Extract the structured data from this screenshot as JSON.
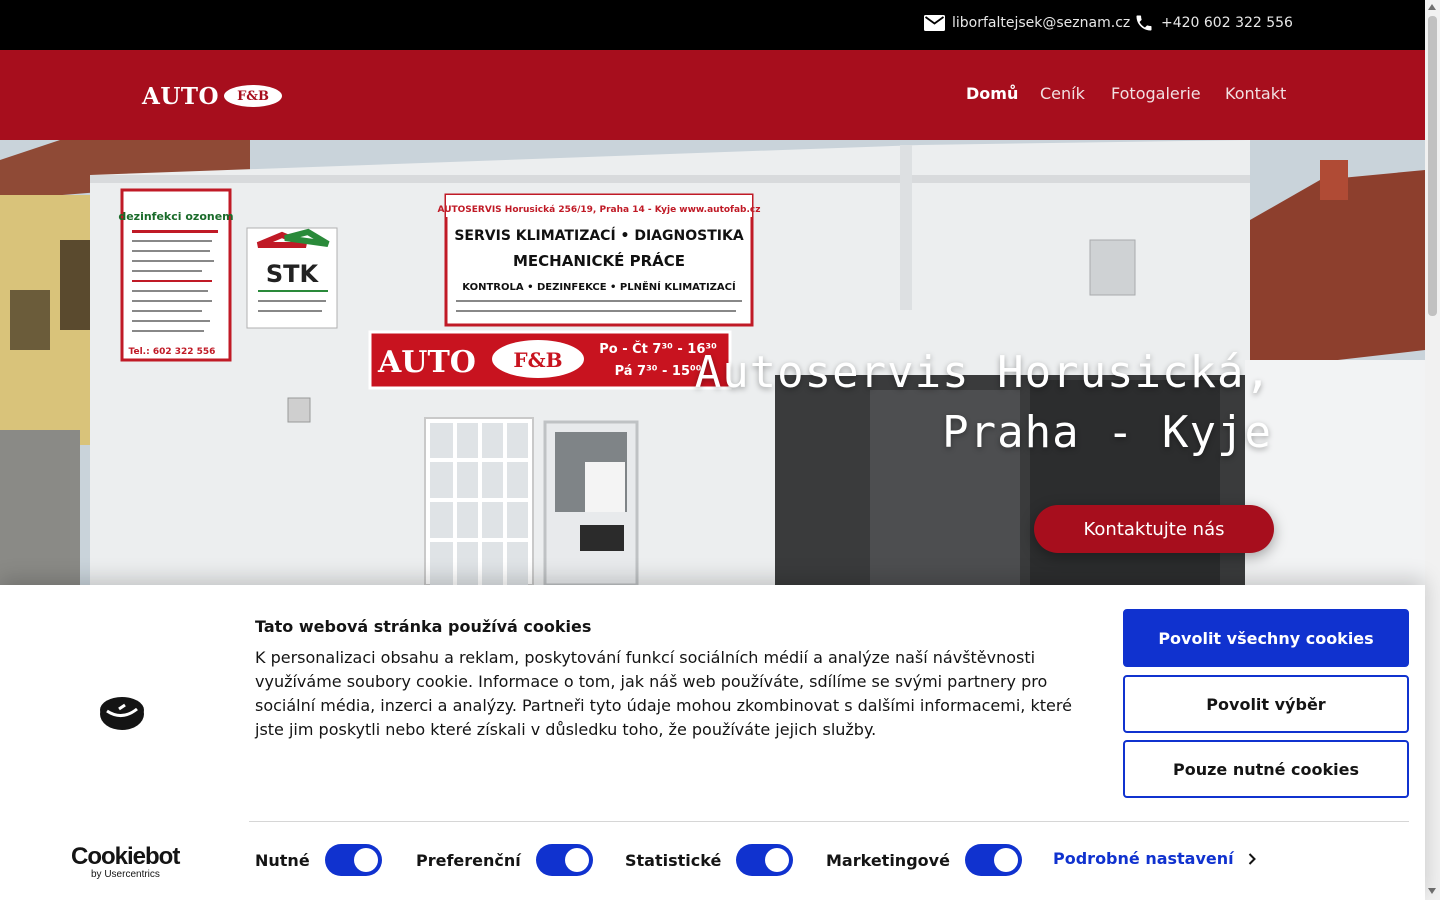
{
  "topbar": {
    "email": "liborfaltejsek@seznam.cz",
    "phone": "+420 602 322 556",
    "email_icon": "mail-icon",
    "phone_icon": "phone-icon"
  },
  "header": {
    "logo_word": "AUTO",
    "logo_badge": "F&B",
    "nav": [
      {
        "label": "Domů",
        "active": true
      },
      {
        "label": "Ceník",
        "active": false
      },
      {
        "label": "Fotogalerie",
        "active": false
      },
      {
        "label": "Kontakt",
        "active": false
      }
    ]
  },
  "hero": {
    "title_line1": "Autoservis Horusická,",
    "title_line2": "Praha - Kyje",
    "cta_label": "Kontaktujte nás",
    "sign_main": "AUTO",
    "sign_badge": "F&B",
    "sign_hours1": "Po - Čt 7³⁰ - 16³⁰",
    "sign_hours2": "Pá 7³⁰ - 15⁰⁰",
    "sign_stk": "STK",
    "sign_service1": "SERVIS KLIMATIZACÍ • DIAGNOSTIKA",
    "sign_service2": "MECHANICKÉ PRÁCE",
    "sign_service3": "KONTROLA • DEZINFEKCE • PLNĚNÍ KLIMATIZACÍ",
    "sign_service_head": "AUTOSERVIS Horusická 256/19, Praha 14 - Kyje www.autofab.cz",
    "sign_left_head": "dezinfekci ozonem",
    "sign_left_phone": "Tel.: 602 322 556"
  },
  "cookie": {
    "title": "Tato webová stránka používá cookies",
    "text": "K personalizaci obsahu a reklam, poskytování funkcí sociálních médií a analýze naší návštěvnosti využíváme soubory cookie. Informace o tom, jak náš web používáte, sdílíme se svými partnery pro sociální média, inzerci a analýzy. Partneři tyto údaje mohou zkombinovat s dalšími informacemi, které jste jim poskytli nebo které získali v důsledku toho, že používáte jejich služby.",
    "btn_allow_all": "Povolit všechny cookies",
    "btn_allow_selection": "Povolit výběr",
    "btn_necessary_only": "Pouze nutné cookies",
    "toggles": [
      {
        "label": "Nutné",
        "on": true
      },
      {
        "label": "Preferenční",
        "on": true
      },
      {
        "label": "Statistické",
        "on": true
      },
      {
        "label": "Marketingové",
        "on": true
      }
    ],
    "details_link": "Podrobné nastavení",
    "brand_name": "Cookiebot",
    "brand_sub": "by Usercentrics"
  },
  "colors": {
    "brand_red": "#a70e1d",
    "cookie_blue": "#1032cf",
    "topbar_black": "#000000"
  }
}
